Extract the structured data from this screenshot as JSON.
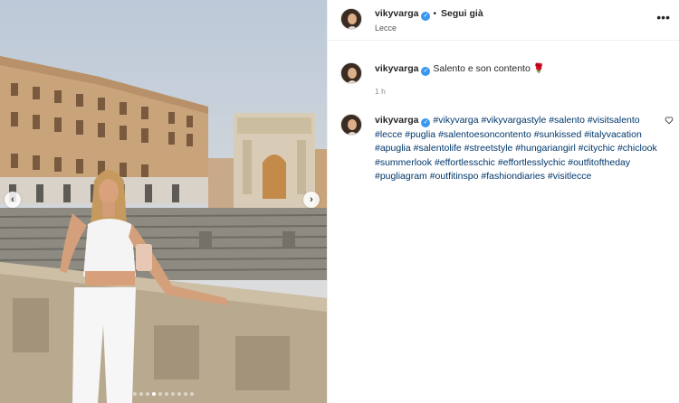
{
  "post": {
    "username": "vikyvarga",
    "follow_label": "Segui già",
    "bullet": "•",
    "location": "Lecce",
    "more_icon": "more-options-icon",
    "verified_icon": "verified-badge-icon"
  },
  "caption": {
    "username": "vikyvarga",
    "text": "Salento e son contento",
    "emoji": "🌹",
    "time": "1 h"
  },
  "hashtag_comment": {
    "username": "vikyvarga",
    "tags": [
      "#vikyvarga",
      "#vikyvargastyle",
      "#salento",
      "#visitsalento",
      "#lecce",
      "#puglia",
      "#salentoesoncontento",
      "#sunkissed",
      "#italyvacation",
      "#apuglia",
      "#salentolife",
      "#streetstyle",
      "#hungariangirl",
      "#citychic",
      "#chiclook",
      "#summerlook",
      "#effortlesschic",
      "#effortlesslychic",
      "#outfitoftheday",
      "#pugliagram",
      "#outfitinspo",
      "#fashiondiaries",
      "#visitlecce"
    ]
  },
  "carousel": {
    "prev_icon": "chevron-left-icon",
    "next_icon": "chevron-right-icon",
    "prev_glyph": "‹",
    "next_glyph": "›",
    "dots_total": 10,
    "active_dot": 3
  },
  "colors": {
    "hashtag": "#00376b",
    "verified": "#3897f0"
  }
}
